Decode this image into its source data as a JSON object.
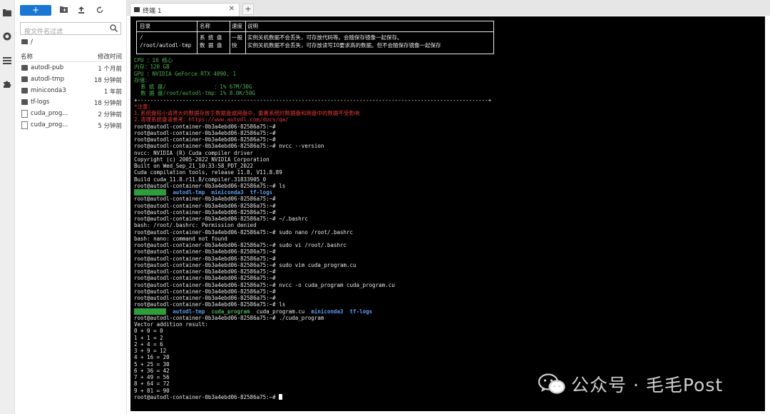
{
  "activity": {
    "icons": [
      "folder-icon",
      "running-icon",
      "list-icon",
      "extension-icon"
    ]
  },
  "file_browser": {
    "new_label": "+",
    "toolbar_icons": [
      "new-folder-icon",
      "upload-icon",
      "refresh-icon"
    ],
    "filter_placeholder": "按文件名过滤",
    "breadcrumb": "/",
    "columns": {
      "name": "名称",
      "modified": "修改时间"
    },
    "files": [
      {
        "type": "folder",
        "name": "autodl-pub",
        "modified": "1 个月前"
      },
      {
        "type": "folder",
        "name": "autodl-tmp",
        "modified": "18 分钟前"
      },
      {
        "type": "folder",
        "name": "miniconda3",
        "modified": "1 年前"
      },
      {
        "type": "folder",
        "name": "tf-logs",
        "modified": "18 分钟前"
      },
      {
        "type": "file",
        "name": "cuda_prog...",
        "modified": "2 分钟前"
      },
      {
        "type": "file",
        "name": "cuda_prog...",
        "modified": "5 分钟前"
      }
    ]
  },
  "tabs": [
    {
      "label": "终端 1",
      "close": "✕"
    }
  ],
  "tab_add": "+",
  "terminal": {
    "storage_table": {
      "headers": [
        "目录",
        "名称",
        "速度",
        "说明"
      ],
      "rows": [
        {
          "dir": "/",
          "name": "系 统 盘",
          "speed": "一般",
          "desc": "实例关机数据不会丢失，可存放代码等。会随保存镜像一起保存。"
        },
        {
          "dir": "/root/autodl-tmp",
          "name": "数 据 盘",
          "speed": "快",
          "desc": "实例关机数据不会丢失，可存放读写IO要求高的数据。但不会随保存镜像一起保存"
        }
      ]
    },
    "lines": [
      [
        {
          "t": "CPU ：16 核心",
          "c": "cg"
        }
      ],
      [
        {
          "t": "内存：120 GB",
          "c": "cg"
        }
      ],
      [
        {
          "t": "GPU ：NVIDIA GeForce RTX 4090, 1",
          "c": "cg"
        }
      ],
      [
        {
          "t": "存储：",
          "c": "cg"
        }
      ],
      [
        {
          "t": "  系 统 盘/               ：1% 67M/30G",
          "c": "cg"
        }
      ],
      [
        {
          "t": "  数 据 盘/root/autodl-tmp：1% 8.0K/50G",
          "c": "cg"
        }
      ],
      [
        {
          "t": "+-------------------------------------------------------------------------------------------------------------+",
          "c": "cw"
        }
      ],
      [
        {
          "t": "*注意：",
          "c": "cr"
        }
      ],
      [
        {
          "t": "1.系统盘较小请将大的数据存放于数据盘或网盘中，重置系统时数据盘和网盘中的数据不受影响",
          "c": "cr"
        }
      ],
      [
        {
          "t": "2.清理系统盘请参考：https://www.autodl.com/docs/qa/",
          "c": "cr"
        }
      ],
      [
        {
          "t": "root@autodl-container-0b3a4ebd06-82586a75:~#",
          "c": "cw"
        }
      ],
      [
        {
          "t": "root@autodl-container-0b3a4ebd06-82586a75:~#",
          "c": "cw"
        }
      ],
      [
        {
          "t": "root@autodl-container-0b3a4ebd06-82586a75:~#",
          "c": "cw"
        }
      ],
      [
        {
          "t": "root@autodl-container-0b3a4ebd06-82586a75:~# nvcc --version",
          "c": "cw"
        }
      ],
      [
        {
          "t": "nvcc: NVIDIA (R) Cuda compiler driver",
          "c": "cw"
        }
      ],
      [
        {
          "t": "Copyright (c) 2005-2022 NVIDIA Corporation",
          "c": "cw"
        }
      ],
      [
        {
          "t": "Built on Wed_Sep_21_10:33:58_PDT_2022",
          "c": "cw"
        }
      ],
      [
        {
          "t": "Cuda compilation tools, release 11.8, V11.8.89",
          "c": "cw"
        }
      ],
      [
        {
          "t": "Build cuda_11.8.r11.8/compiler.31833905_0",
          "c": "cw"
        }
      ],
      [
        {
          "t": "root@autodl-container-0b3a4ebd06-82586a75:~# ls",
          "c": "cw"
        }
      ],
      [
        {
          "t": "autodl-pub",
          "c": "hl"
        },
        {
          "t": "  ",
          "c": "cw"
        },
        {
          "t": "autodl-tmp",
          "c": "cb"
        },
        {
          "t": "  ",
          "c": "cw"
        },
        {
          "t": "miniconda3",
          "c": "cb"
        },
        {
          "t": "  ",
          "c": "cw"
        },
        {
          "t": "tf-logs",
          "c": "cb"
        }
      ],
      [
        {
          "t": "root@autodl-container-0b3a4ebd06-82586a75:~#",
          "c": "cw"
        }
      ],
      [
        {
          "t": "root@autodl-container-0b3a4ebd06-82586a75:~#",
          "c": "cw"
        }
      ],
      [
        {
          "t": "root@autodl-container-0b3a4ebd06-82586a75:~#",
          "c": "cw"
        }
      ],
      [
        {
          "t": "root@autodl-container-0b3a4ebd06-82586a75:~# ~/.bashrc",
          "c": "cw"
        }
      ],
      [
        {
          "t": "bash: /root/.bashrc: Permission denied",
          "c": "cw"
        }
      ],
      [
        {
          "t": "root@autodl-container-0b3a4ebd06-82586a75:~# sudo nano /root/.bashrc",
          "c": "cw"
        }
      ],
      [
        {
          "t": "bash: nano: command not found",
          "c": "cw"
        }
      ],
      [
        {
          "t": "root@autodl-container-0b3a4ebd06-82586a75:~# sudo vi /root/.bashrc",
          "c": "cw"
        }
      ],
      [
        {
          "t": "root@autodl-container-0b3a4ebd06-82586a75:~#",
          "c": "cw"
        }
      ],
      [
        {
          "t": "root@autodl-container-0b3a4ebd06-82586a75:~#",
          "c": "cw"
        }
      ],
      [
        {
          "t": "root@autodl-container-0b3a4ebd06-82586a75:~# sudo vim cuda_program.cu",
          "c": "cw"
        }
      ],
      [
        {
          "t": "root@autodl-container-0b3a4ebd06-82586a75:~#",
          "c": "cw"
        }
      ],
      [
        {
          "t": "root@autodl-container-0b3a4ebd06-82586a75:~#",
          "c": "cw"
        }
      ],
      [
        {
          "t": "root@autodl-container-0b3a4ebd06-82586a75:~# nvcc -o cuda_program cuda_program.cu",
          "c": "cw"
        }
      ],
      [
        {
          "t": "root@autodl-container-0b3a4ebd06-82586a75:~#",
          "c": "cw"
        }
      ],
      [
        {
          "t": "root@autodl-container-0b3a4ebd06-82586a75:~#",
          "c": "cw"
        }
      ],
      [
        {
          "t": "root@autodl-container-0b3a4ebd06-82586a75:~# ls",
          "c": "cw"
        }
      ],
      [
        {
          "t": "autodl-pub",
          "c": "hl"
        },
        {
          "t": "  ",
          "c": "cw"
        },
        {
          "t": "autodl-tmp",
          "c": "cb"
        },
        {
          "t": "  ",
          "c": "cw"
        },
        {
          "t": "cuda_program",
          "c": "cgb"
        },
        {
          "t": "  cuda_program.cu  ",
          "c": "cw"
        },
        {
          "t": "miniconda3",
          "c": "cb"
        },
        {
          "t": "  ",
          "c": "cw"
        },
        {
          "t": "tf-logs",
          "c": "cb"
        }
      ],
      [
        {
          "t": "root@autodl-container-0b3a4ebd06-82586a75:~# ./cuda_program",
          "c": "cw"
        }
      ],
      [
        {
          "t": "Vector addition result:",
          "c": "cw"
        }
      ],
      [
        {
          "t": "0 + 0 = 0",
          "c": "cw"
        }
      ],
      [
        {
          "t": "1 + 1 = 2",
          "c": "cw"
        }
      ],
      [
        {
          "t": "2 + 4 = 6",
          "c": "cw"
        }
      ],
      [
        {
          "t": "3 + 9 = 12",
          "c": "cw"
        }
      ],
      [
        {
          "t": "4 + 16 = 20",
          "c": "cw"
        }
      ],
      [
        {
          "t": "5 + 25 = 30",
          "c": "cw"
        }
      ],
      [
        {
          "t": "6 + 36 = 42",
          "c": "cw"
        }
      ],
      [
        {
          "t": "7 + 49 = 56",
          "c": "cw"
        }
      ],
      [
        {
          "t": "8 + 64 = 72",
          "c": "cw"
        }
      ],
      [
        {
          "t": "9 + 81 = 90",
          "c": "cw"
        }
      ],
      [
        {
          "t": "root@autodl-container-0b3a4ebd06-82586a75:~# ",
          "c": "cw"
        },
        {
          "t": "",
          "c": "cursor"
        }
      ]
    ]
  },
  "watermark": {
    "text": "公众号 · 毛毛Post"
  },
  "colors": {
    "accent": "#1976d2",
    "terminal_bg": "#000000",
    "prompt_green": "#4caf50",
    "warning_red": "#e53935",
    "dir_blue": "#5c9ded"
  }
}
